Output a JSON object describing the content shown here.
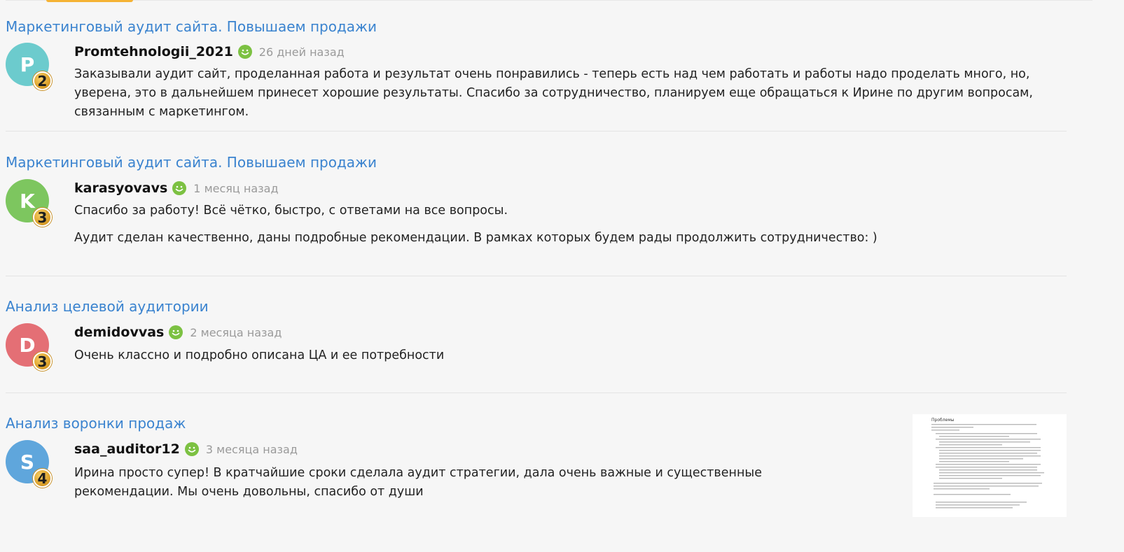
{
  "colors": {
    "link": "#3a83cf",
    "avatar_p": "#6ccbcd",
    "avatar_k": "#7dc65f",
    "avatar_d": "#e46f75",
    "avatar_s": "#5fa6dc",
    "badge_gold": "#e0a52c",
    "smile_green": "#7cc142"
  },
  "reviews": [
    {
      "service_title": "Маркетинговый аудит сайта. Повышаем продажи",
      "avatar_letter": "P",
      "level": "2",
      "username": "Promtehnologii_2021",
      "time": "26 дней назад",
      "paragraphs": [
        "Заказывали аудит сайт, проделанная работа и результат очень понравились - теперь есть над чем работать и работы надо проделать много, но, уверена, это в дальнейшем принесет хорошие результаты. Спасибо за сотрудничество, планируем еще обращаться к Ирине по другим вопросам, связанным с маркетингом."
      ]
    },
    {
      "service_title": "Маркетинговый аудит сайта. Повышаем продажи",
      "avatar_letter": "K",
      "level": "3",
      "username": "karasyovavs",
      "time": "1 месяц назад",
      "paragraphs": [
        "Спасибо за работу! Всё чётко, быстро, с ответами на все вопросы.",
        "Аудит сделан качественно, даны подробные рекомендации. В рамках которых будем рады продолжить сотрудничество: )"
      ]
    },
    {
      "service_title": "Анализ целевой аудитории",
      "avatar_letter": "D",
      "level": "3",
      "username": "demidovvas",
      "time": "2 месяца назад",
      "paragraphs": [
        "Очень классно и подробно описана ЦА и ее потребности"
      ]
    },
    {
      "service_title": "Анализ воронки продаж",
      "avatar_letter": "S",
      "level": "4",
      "username": "saa_auditor12",
      "time": "3 месяца назад",
      "paragraphs": [
        "Ирина просто супер! В кратчайшие сроки сделала аудит стратегии, дала очень важные и существенные рекомендации. Мы очень довольны, спасибо от души"
      ],
      "attachment": {
        "heading": "Проблемы"
      }
    }
  ]
}
